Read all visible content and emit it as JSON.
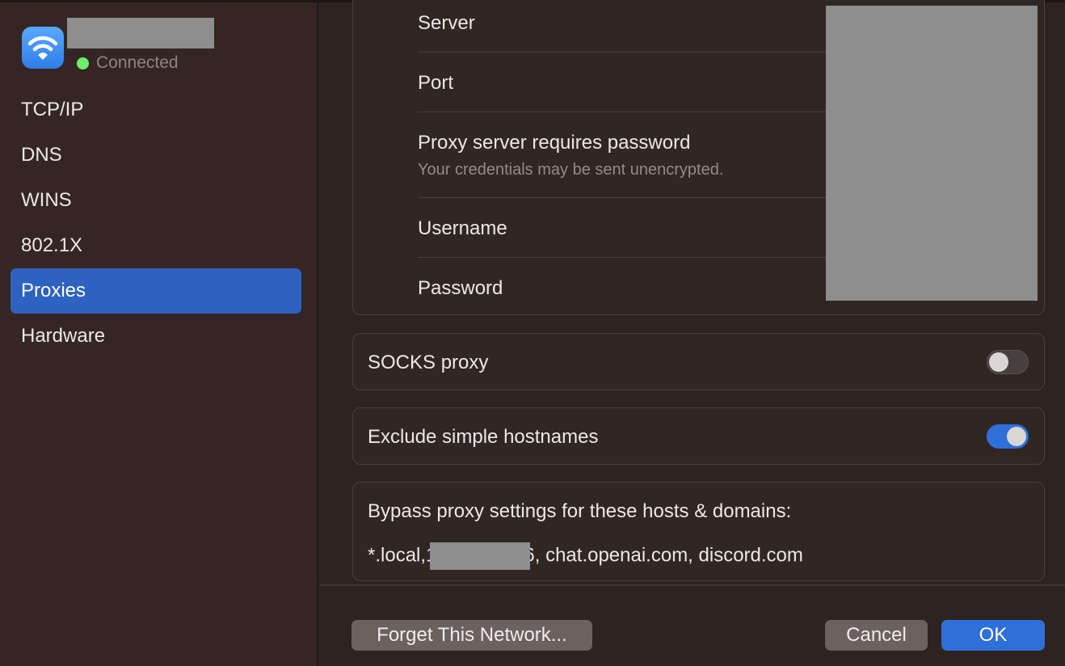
{
  "sidebar": {
    "network_status": "Connected",
    "status_color": "#6ef06a",
    "items": [
      {
        "label": "TCP/IP"
      },
      {
        "label": "DNS"
      },
      {
        "label": "WINS"
      },
      {
        "label": "802.1X"
      },
      {
        "label": "Proxies",
        "active": true
      },
      {
        "label": "Hardware"
      }
    ]
  },
  "proxy_details": {
    "server_label": "Server",
    "port_label": "Port",
    "password_required_label": "Proxy server requires password",
    "password_required_note": "Your credentials may be sent unencrypted.",
    "username_label": "Username",
    "password_label": "Password"
  },
  "socks": {
    "label": "SOCKS proxy",
    "enabled": false
  },
  "exclude_simple": {
    "label": "Exclude simple hostnames",
    "enabled": true
  },
  "bypass": {
    "label": "Bypass proxy settings for these hosts & domains:",
    "value_prefix": "*.local,1",
    "value_suffix": "6, chat.openai.com, discord.com"
  },
  "footer": {
    "forget_label": "Forget This Network...",
    "cancel_label": "Cancel",
    "ok_label": "OK"
  },
  "colors": {
    "accent": "#2f6fd8"
  }
}
